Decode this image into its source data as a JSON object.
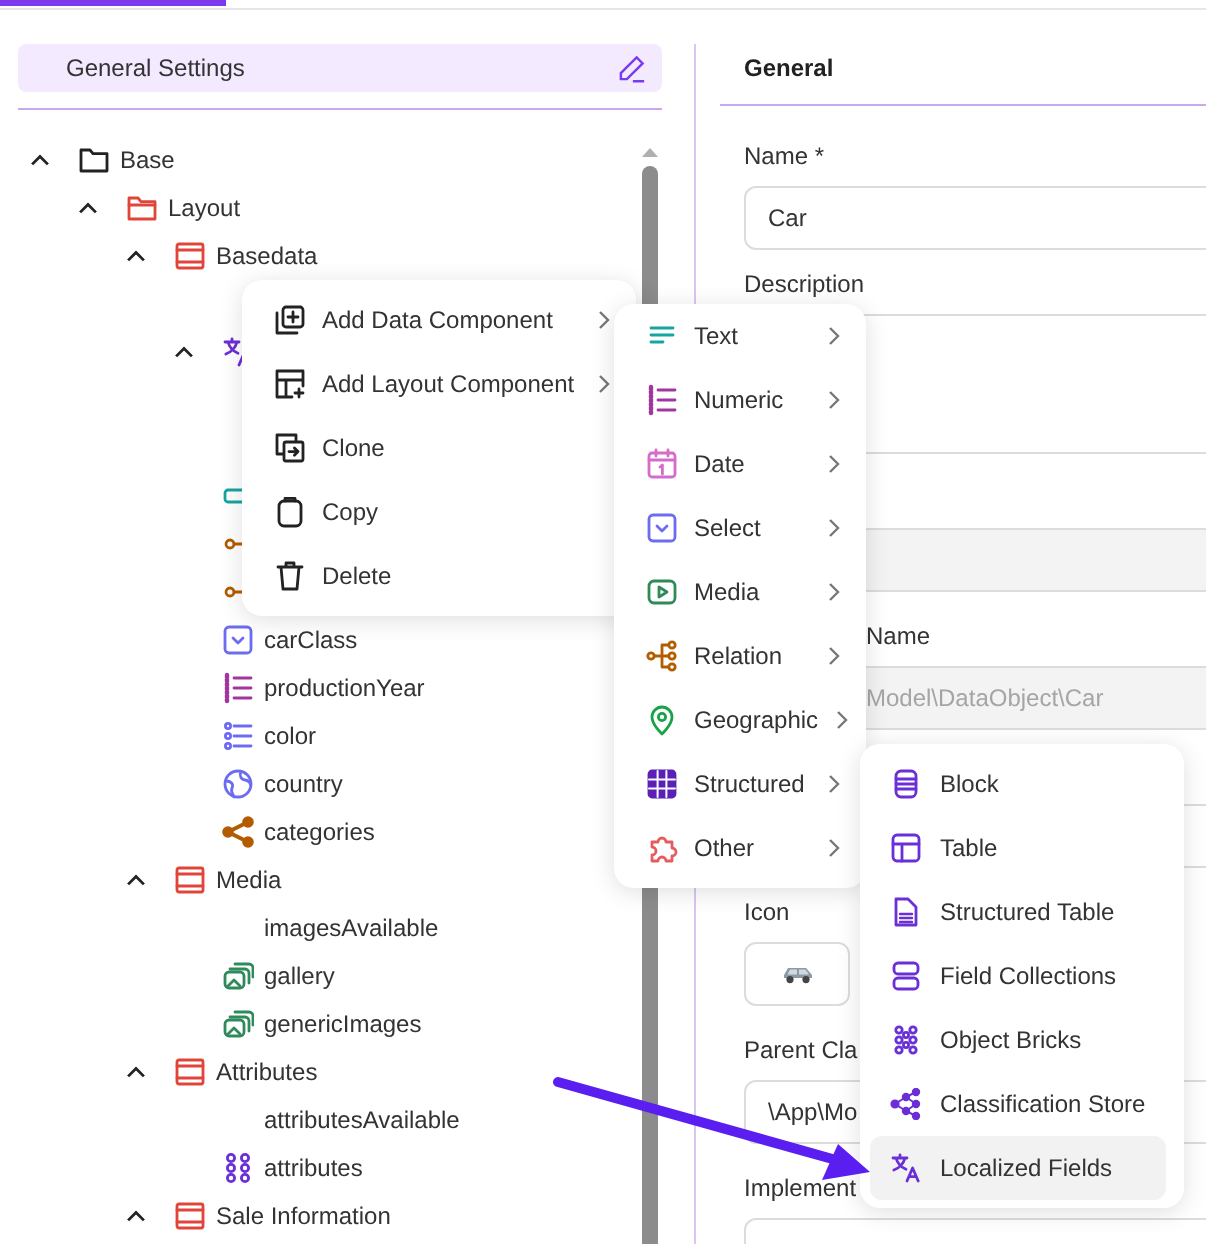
{
  "sidebar": {
    "header": {
      "title": "General Settings"
    },
    "tree": [
      {
        "label": "Base",
        "kind": "folder",
        "expanded": true,
        "children": [
          {
            "label": "Layout",
            "kind": "layout",
            "expanded": true,
            "children": [
              {
                "label": "Basedata",
                "kind": "panel",
                "expanded": true,
                "children": [
                  {
                    "kind": "covered"
                  },
                  {
                    "kind": "localized",
                    "expanded": true
                  },
                  {
                    "kind": "input"
                  },
                  {
                    "kind": "relation"
                  },
                  {
                    "kind": "relation"
                  },
                  {
                    "label": "carClass",
                    "kind": "select"
                  },
                  {
                    "label": "productionYear",
                    "kind": "numeric"
                  },
                  {
                    "label": "color",
                    "kind": "multiselect"
                  },
                  {
                    "label": "country",
                    "kind": "country"
                  },
                  {
                    "label": "categories",
                    "kind": "share"
                  }
                ]
              },
              {
                "label": "Media",
                "kind": "panel",
                "expanded": true,
                "children": [
                  {
                    "label": "imagesAvailable",
                    "kind": "plain"
                  },
                  {
                    "label": "gallery",
                    "kind": "gallery"
                  },
                  {
                    "label": "genericImages",
                    "kind": "gallery"
                  }
                ]
              },
              {
                "label": "Attributes",
                "kind": "panel",
                "expanded": true,
                "children": [
                  {
                    "label": "attributesAvailable",
                    "kind": "plain"
                  },
                  {
                    "label": "attributes",
                    "kind": "bricks"
                  }
                ]
              },
              {
                "label": "Sale Information",
                "kind": "panel",
                "expanded": true
              }
            ]
          }
        ]
      }
    ]
  },
  "form": {
    "section": "General",
    "fields": [
      {
        "kind": "input",
        "label": "Name *",
        "value": "Car",
        "disabled": false
      },
      {
        "kind": "textarea",
        "label": "Description"
      },
      {
        "kind": "input",
        "disabled": true
      },
      {
        "kind": "input",
        "label": "Name",
        "value": "Model\\DataObject\\Car",
        "disabled": true,
        "cut": true
      },
      {
        "kind": "input",
        "disabled": false
      },
      {
        "kind": "icon",
        "label": "Icon"
      },
      {
        "kind": "input",
        "label": "Parent Cla",
        "value": "\\App\\Mo",
        "disabled": false
      },
      {
        "kind": "input",
        "label": "Implement",
        "disabled": false
      }
    ]
  },
  "context_menu": {
    "items": [
      {
        "label": "Add Data Component",
        "kind": "add-data",
        "submenu": true
      },
      {
        "label": "Add Layout Component",
        "kind": "add-layout",
        "submenu": true
      },
      {
        "label": "Clone",
        "kind": "clone",
        "submenu": false
      },
      {
        "label": "Copy",
        "kind": "copy",
        "submenu": false
      },
      {
        "label": "Delete",
        "kind": "delete",
        "submenu": false
      }
    ]
  },
  "data_component_menu": {
    "items": [
      {
        "label": "Text",
        "kind": "text",
        "submenu": true
      },
      {
        "label": "Numeric",
        "kind": "numeric",
        "submenu": true
      },
      {
        "label": "Date",
        "kind": "date",
        "submenu": true
      },
      {
        "label": "Select",
        "kind": "select",
        "submenu": true
      },
      {
        "label": "Media",
        "kind": "media",
        "submenu": true
      },
      {
        "label": "Relation",
        "kind": "relation-tree",
        "submenu": true
      },
      {
        "label": "Geographic",
        "kind": "geo",
        "submenu": true
      },
      {
        "label": "Structured",
        "kind": "structured",
        "submenu": true
      },
      {
        "label": "Other",
        "kind": "other",
        "submenu": true
      }
    ]
  },
  "structured_menu": {
    "items": [
      {
        "label": "Block",
        "kind": "block",
        "hovered": false
      },
      {
        "label": "Table",
        "kind": "table",
        "hovered": false
      },
      {
        "label": "Structured Table",
        "kind": "structured-table",
        "hovered": false
      },
      {
        "label": "Field Collections",
        "kind": "field-collections",
        "hovered": false
      },
      {
        "label": "Object Bricks",
        "kind": "object-bricks",
        "hovered": false
      },
      {
        "label": "Classification Store",
        "kind": "classification",
        "hovered": false
      },
      {
        "label": "Localized Fields",
        "kind": "localized",
        "hovered": true
      }
    ]
  }
}
